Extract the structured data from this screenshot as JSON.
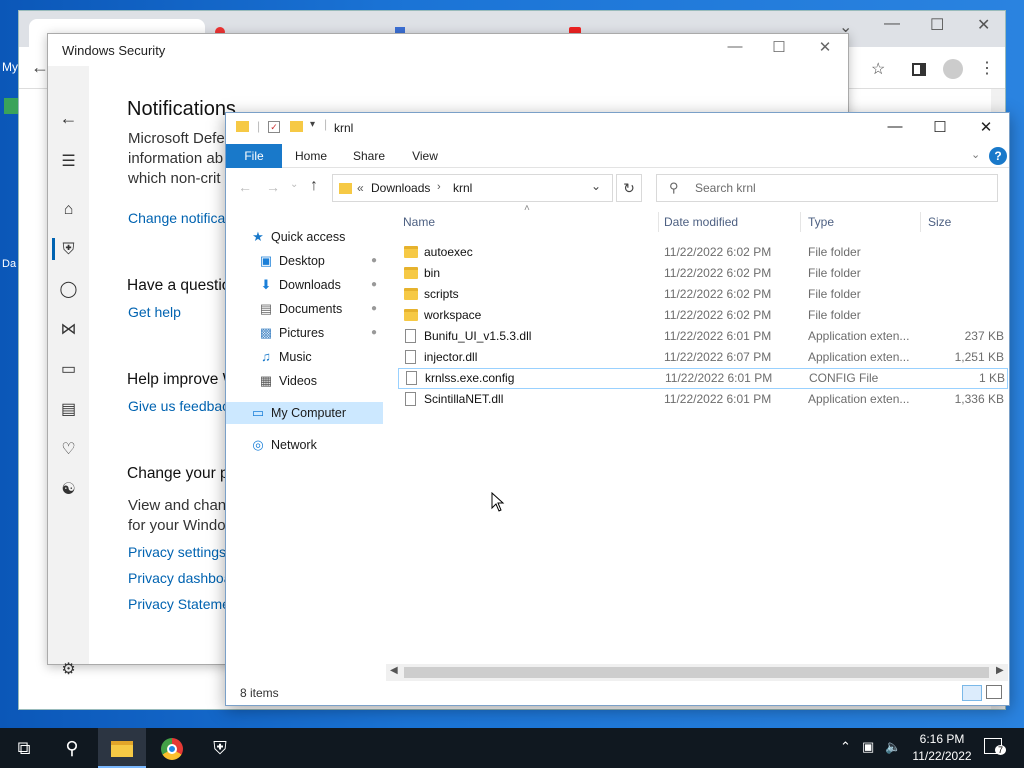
{
  "desktop": {
    "icon1_label": "My",
    "icon2_label": "Da"
  },
  "windows_security": {
    "title": "Windows Security",
    "heading": "Notifications",
    "desc_lines": [
      "Microsoft Defe",
      "information ab",
      "which non-crit"
    ],
    "change_notifications_link": "Change notifica",
    "question_heading": "Have a questio",
    "get_help_link": "Get help",
    "improve_heading": "Help improve W",
    "feedback_link": "Give us feedbac",
    "privacy_heading": "Change your p",
    "privacy_desc_lines": [
      "View and chan",
      "for your Windo"
    ],
    "privacy_settings_link": "Privacy settings",
    "privacy_dashboard_link": "Privacy dashboa",
    "privacy_statement_link": "Privacy Stateme"
  },
  "explorer": {
    "title": "krnl",
    "ribbon_tabs": [
      "File",
      "Home",
      "Share",
      "View"
    ],
    "breadcrumb": {
      "overflow": "«",
      "parent": "Downloads",
      "current": "krnl"
    },
    "search_placeholder": "Search krnl",
    "tree": {
      "quick_access": "Quick access",
      "desktop": "Desktop",
      "downloads": "Downloads",
      "documents": "Documents",
      "pictures": "Pictures",
      "music": "Music",
      "videos": "Videos",
      "my_computer": "My Computer",
      "network": "Network"
    },
    "columns": {
      "name": "Name",
      "date": "Date modified",
      "type": "Type",
      "size": "Size"
    },
    "files": [
      {
        "name": "autoexec",
        "date": "11/22/2022 6:02 PM",
        "type": "File folder",
        "size": ""
      },
      {
        "name": "bin",
        "date": "11/22/2022 6:02 PM",
        "type": "File folder",
        "size": ""
      },
      {
        "name": "scripts",
        "date": "11/22/2022 6:02 PM",
        "type": "File folder",
        "size": ""
      },
      {
        "name": "workspace",
        "date": "11/22/2022 6:02 PM",
        "type": "File folder",
        "size": ""
      },
      {
        "name": "Bunifu_UI_v1.5.3.dll",
        "date": "11/22/2022 6:01 PM",
        "type": "Application exten...",
        "size": "237 KB"
      },
      {
        "name": "injector.dll",
        "date": "11/22/2022 6:07 PM",
        "type": "Application exten...",
        "size": "1,251 KB"
      },
      {
        "name": "krnlss.exe.config",
        "date": "11/22/2022 6:01 PM",
        "type": "CONFIG File",
        "size": "1 KB"
      },
      {
        "name": "ScintillaNET.dll",
        "date": "11/22/2022 6:01 PM",
        "type": "Application exten...",
        "size": "1,336 KB"
      }
    ],
    "status": "8 items"
  },
  "taskbar": {
    "time": "6:16 PM",
    "date": "11/22/2022",
    "notification_count": "7"
  },
  "colors": {
    "accent": "#1979ca",
    "link": "#0063b1",
    "taskbar": "#101820"
  }
}
